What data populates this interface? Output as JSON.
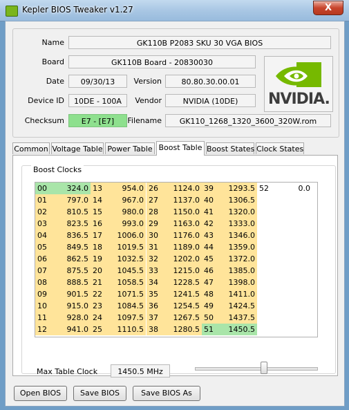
{
  "window": {
    "title": "Kepler BIOS Tweaker v1.27",
    "close_label": "X"
  },
  "info": {
    "name_label": "Name",
    "name_value": "GK110B P2083 SKU 30 VGA BIOS",
    "board_label": "Board",
    "board_value": "GK110B Board - 20830030",
    "date_label": "Date",
    "date_value": "09/30/13",
    "version_label": "Version",
    "version_value": "80.80.30.00.01",
    "device_label": "Device ID",
    "device_value": "10DE - 100A",
    "vendor_label": "Vendor",
    "vendor_value": "NVIDIA (10DE)",
    "checksum_label": "Checksum",
    "checksum_value": "E7 - [E7]",
    "filename_label": "Filename",
    "filename_value": "GK110_1268_1320_3600_320W.rom",
    "logo_text": "NVIDIA."
  },
  "tabs": [
    "Common",
    "Voltage Table",
    "Power Table",
    "Boost Table",
    "Boost States",
    "Clock States"
  ],
  "active_tab": "Boost Table",
  "boost": {
    "group_label": "Boost Clocks",
    "columns": [
      [
        [
          "00",
          "324.0"
        ],
        [
          "01",
          "797.0"
        ],
        [
          "02",
          "810.5"
        ],
        [
          "03",
          "823.5"
        ],
        [
          "04",
          "836.5"
        ],
        [
          "05",
          "849.5"
        ],
        [
          "06",
          "862.5"
        ],
        [
          "07",
          "875.5"
        ],
        [
          "08",
          "888.5"
        ],
        [
          "09",
          "901.5"
        ],
        [
          "10",
          "915.0"
        ],
        [
          "11",
          "928.0"
        ],
        [
          "12",
          "941.0"
        ]
      ],
      [
        [
          "13",
          "954.0"
        ],
        [
          "14",
          "967.0"
        ],
        [
          "15",
          "980.0"
        ],
        [
          "16",
          "993.0"
        ],
        [
          "17",
          "1006.0"
        ],
        [
          "18",
          "1019.5"
        ],
        [
          "19",
          "1032.5"
        ],
        [
          "20",
          "1045.5"
        ],
        [
          "21",
          "1058.5"
        ],
        [
          "22",
          "1071.5"
        ],
        [
          "23",
          "1084.5"
        ],
        [
          "24",
          "1097.5"
        ],
        [
          "25",
          "1110.5"
        ]
      ],
      [
        [
          "26",
          "1124.0"
        ],
        [
          "27",
          "1137.0"
        ],
        [
          "28",
          "1150.0"
        ],
        [
          "29",
          "1163.0"
        ],
        [
          "30",
          "1176.0"
        ],
        [
          "31",
          "1189.0"
        ],
        [
          "32",
          "1202.0"
        ],
        [
          "33",
          "1215.0"
        ],
        [
          "34",
          "1228.5"
        ],
        [
          "35",
          "1241.5"
        ],
        [
          "36",
          "1254.5"
        ],
        [
          "37",
          "1267.5"
        ],
        [
          "38",
          "1280.5"
        ]
      ],
      [
        [
          "39",
          "1293.5"
        ],
        [
          "40",
          "1306.5"
        ],
        [
          "41",
          "1320.0"
        ],
        [
          "42",
          "1333.0"
        ],
        [
          "43",
          "1346.0"
        ],
        [
          "44",
          "1359.0"
        ],
        [
          "45",
          "1372.0"
        ],
        [
          "46",
          "1385.0"
        ],
        [
          "47",
          "1398.0"
        ],
        [
          "48",
          "1411.0"
        ],
        [
          "49",
          "1424.5"
        ],
        [
          "50",
          "1437.5"
        ],
        [
          "51",
          "1450.5"
        ]
      ],
      [
        [
          "52",
          "0.0"
        ]
      ]
    ],
    "max_label": "Max Table Clock",
    "max_value": "1450.5 MHz",
    "slider_level": 0.57,
    "colors": {
      "yellow": "#ffe49a",
      "green": "#a9e5a9",
      "white": "#ffffff"
    }
  },
  "buttons": {
    "open": "Open BIOS",
    "save": "Save BIOS",
    "save_as": "Save BIOS As"
  }
}
